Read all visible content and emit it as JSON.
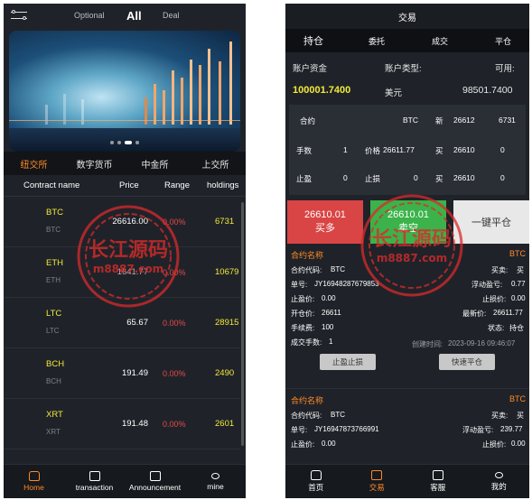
{
  "left": {
    "header_tabs": [
      "Optional",
      "All",
      "Deal"
    ],
    "exchanges": [
      "纽交所",
      "数字货币",
      "中金所",
      "上交所"
    ],
    "columns": [
      "Contract name",
      "Price",
      "Range",
      "holdings"
    ],
    "rows": [
      {
        "symbol": "BTC",
        "sub": "BTC",
        "price": "26616.00",
        "range": "0.00%",
        "holdings": "6731"
      },
      {
        "symbol": "ETH",
        "sub": "ETH",
        "price": "1641.77",
        "range": "0.00%",
        "holdings": "10679"
      },
      {
        "symbol": "LTC",
        "sub": "LTC",
        "price": "65.67",
        "range": "0.00%",
        "holdings": "28915"
      },
      {
        "symbol": "BCH",
        "sub": "BCH",
        "price": "191.49",
        "range": "0.00%",
        "holdings": "2490"
      },
      {
        "symbol": "XRT",
        "sub": "XRT",
        "price": "191.48",
        "range": "0.00%",
        "holdings": "2601"
      }
    ],
    "nav": [
      "Home",
      "transaction",
      "Announcement",
      "mine"
    ]
  },
  "right": {
    "title": "交易",
    "tabs": [
      "持仓",
      "委托",
      "成交",
      "平仓"
    ],
    "account": {
      "funds_label": "账户资金",
      "type_label": "账户类型:",
      "avail_label": "可用:",
      "funds": "100001.7400",
      "type": "美元",
      "avail": "98501.7400"
    },
    "quote": {
      "contract_label": "合约",
      "contract": "BTC",
      "new_label": "新",
      "new_price": "26612",
      "new_qty": "6731",
      "lots_label": "手数",
      "lots": "1",
      "price_label": "价格",
      "price": "26611.77",
      "buy1_label": "买",
      "buy1_price": "26610",
      "buy1_qty": "0",
      "tp_label": "止盈",
      "tp": "0",
      "sl_label": "止损",
      "sl": "0",
      "buy2_label": "买",
      "buy2_price": "26610",
      "buy2_qty": "0"
    },
    "buttons": {
      "buy_price": "26610.01",
      "buy_label": "买多",
      "sell_price": "26610.01",
      "sell_label": "卖空",
      "close_label": "一键平仓"
    },
    "positions": [
      {
        "name_label": "合约名称",
        "name": "BTC",
        "code_label": "合约代码:",
        "code": "BTC",
        "dir_label": "买卖:",
        "dir": "买",
        "order_label": "单号:",
        "order": "JY16948287679853",
        "pl_label": "浮动盈亏:",
        "pl": "0.77",
        "tp_label": "止盈价:",
        "tp": "0.00",
        "sl_label": "止损价:",
        "sl": "0.00",
        "open_label": "开仓价:",
        "open": "26611",
        "latest_label": "最新价:",
        "latest": "26611.77",
        "fee_label": "手续费:",
        "fee": "100",
        "state_label": "状态:",
        "state": "持仓",
        "qty_label": "成交手数:",
        "qty": "1",
        "time_label": "创建时间:",
        "time": "2023-09-16 09:46:07",
        "btn_tpsl": "止盈止损",
        "btn_close": "快速平仓"
      },
      {
        "name_label": "合约名称",
        "name": "BTC",
        "code_label": "合约代码:",
        "code": "BTC",
        "dir_label": "买卖:",
        "dir": "买",
        "order_label": "单号:",
        "order": "JY16947873766991",
        "pl_label": "浮动盈亏:",
        "pl": "239.77",
        "tp_label": "止盈价:",
        "tp": "0.00",
        "sl_label": "止损价:",
        "sl": "0.00"
      }
    ],
    "nav": [
      "首页",
      "交易",
      "客服",
      "我的"
    ]
  },
  "watermark": {
    "main": "长江源码",
    "sub": "m8887.com"
  },
  "colors": {
    "accent": "#ff8a29",
    "yellow": "#f3e93a",
    "red": "#e54a4a",
    "buy": "#d94545",
    "sell": "#3bb34a"
  }
}
